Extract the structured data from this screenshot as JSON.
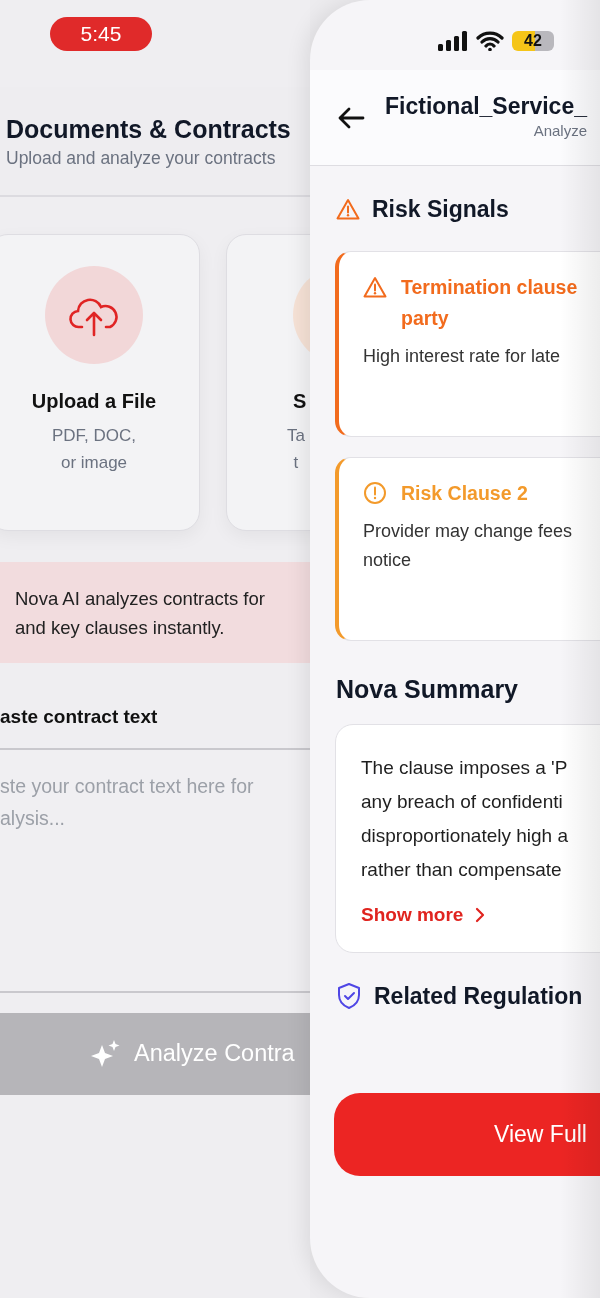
{
  "status_bar": {
    "time": "5:45",
    "battery": "42"
  },
  "upload_screen": {
    "title": "Documents & Contracts",
    "subtitle": "Upload and analyze your contracts",
    "options": [
      {
        "kind": "upload",
        "title": "Upload a File",
        "description": "PDF, DOC,\nor image"
      },
      {
        "kind": "scan",
        "title": "S",
        "description": "Ta\nt"
      }
    ],
    "info": "Nova AI analyzes contracts for\nand key clauses instantly.",
    "paste_label": "aste contract text",
    "paste_field": {
      "placeholder": "ste your contract text here for\nalysis..."
    },
    "analyze_button": {
      "label": "Analyze Contra",
      "disabled": true
    }
  },
  "detail_screen": {
    "title": "Fictional_Service_",
    "subtitle": "Analyze",
    "risk_heading": "Risk Signals",
    "risks": [
      {
        "kind": "warning",
        "color": "#f26b1d",
        "title": "Termination clause\nparty",
        "description": "High interest rate for late"
      },
      {
        "kind": "alert",
        "color": "#f39a2b",
        "title": "Risk Clause 2",
        "description": "Provider may change fees\nnotice"
      }
    ],
    "summary_heading": "Nova Summary",
    "summary": {
      "text": "The clause imposes a 'P\nany breach of confidenti\ndisproportionately high a\nrather than compensate",
      "link": "Show more"
    },
    "regulations_heading": "Related Regulation",
    "primary_button": "View Full"
  }
}
